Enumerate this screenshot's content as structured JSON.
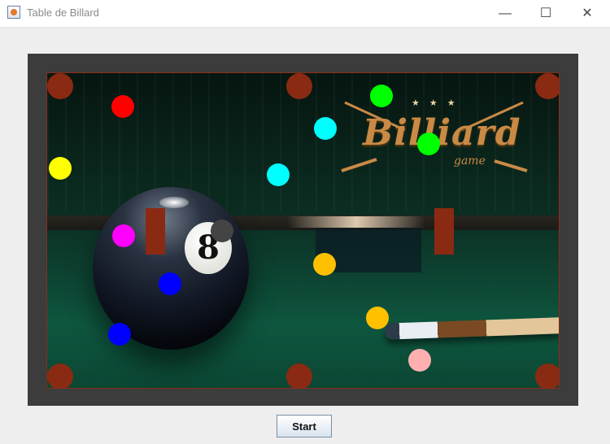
{
  "window": {
    "title": "Table de Billard",
    "icon": "java-app-icon",
    "controls": [
      "minimize",
      "maximize",
      "close"
    ]
  },
  "table": {
    "background": "billiard-8ball-photo",
    "logo_text": "Billiard",
    "logo_sub": "game",
    "ball8_number": "8",
    "pocket_color": "#8a2a12",
    "border_color": "#3c3c3c"
  },
  "balls": [
    {
      "color": "#ff0000"
    },
    {
      "color": "#00ff00"
    },
    {
      "color": "#00ffff"
    },
    {
      "color": "#00ff00"
    },
    {
      "color": "#ffff00"
    },
    {
      "color": "#00ffff"
    },
    {
      "color": "#ff00ff"
    },
    {
      "color": "#444444"
    },
    {
      "color": "#ffc000"
    },
    {
      "color": "#0000ff"
    },
    {
      "color": "#ffc000"
    },
    {
      "color": "#0000ff"
    },
    {
      "color": "#ffafaf"
    }
  ],
  "footer": {
    "start_label": "Start"
  }
}
